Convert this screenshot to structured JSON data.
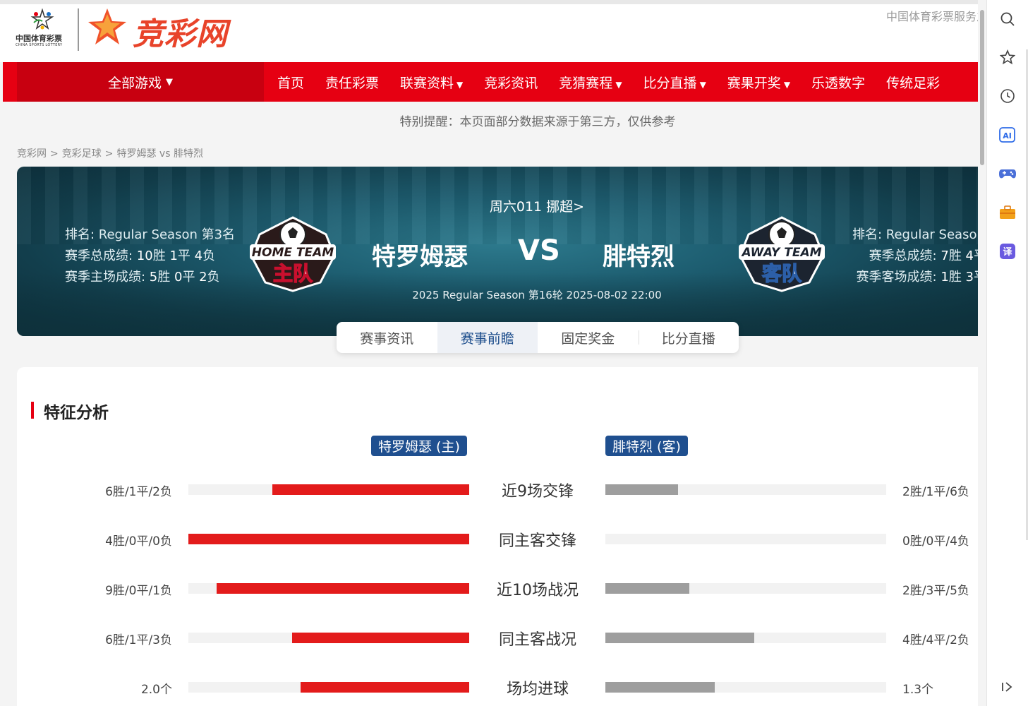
{
  "header": {
    "csl_logo_cn": "中国体育彩票",
    "csl_logo_en": "CHINA SPORTS LOTTERY",
    "site_logo": "竞彩网",
    "service_text": "中国体育彩票服务之"
  },
  "nav": {
    "all_games": "全部游戏",
    "items": [
      {
        "label": "首页",
        "caret": false
      },
      {
        "label": "责任彩票",
        "caret": false
      },
      {
        "label": "联赛资料",
        "caret": true
      },
      {
        "label": "竞彩资讯",
        "caret": false
      },
      {
        "label": "竞猜赛程",
        "caret": true
      },
      {
        "label": "比分直播",
        "caret": true
      },
      {
        "label": "赛果开奖",
        "caret": true
      },
      {
        "label": "乐透数字",
        "caret": false
      },
      {
        "label": "传统足彩",
        "caret": false
      }
    ]
  },
  "notice": "特别提醒：本页面部分数据来源于第三方，仅供参考",
  "breadcrumb": [
    "竞彩网",
    "竞彩足球",
    "特罗姆瑟 vs 腓特烈"
  ],
  "match": {
    "info": "周六011 挪超>",
    "vs": "VS",
    "meta": "2025 Regular Season 第16轮 2025-08-02 22:00",
    "home": {
      "name": "特罗姆瑟",
      "badge_text_en": "HOME TEAM",
      "badge_text_cn": "主队",
      "rank_label": "排名: Regular Season 第3名",
      "total_label": "赛季总成绩: ",
      "total_w": "10",
      "total_d": "1",
      "total_l": "4",
      "venue_label": "赛季主场成绩: ",
      "venue_w": "5",
      "venue_d": "0",
      "venue_l": "2"
    },
    "away": {
      "name": "腓特烈",
      "badge_text_en": "AWAY TEAM",
      "badge_text_cn": "客队",
      "rank_label": "排名: Regular Season 第",
      "total_label": "赛季总成绩: ",
      "total_w": "7",
      "total_d": "4",
      "venue_label": "赛季客场成绩: ",
      "venue_w": "1",
      "venue_d": "3"
    }
  },
  "tabs": [
    {
      "label": "赛事资讯",
      "active": false
    },
    {
      "label": "赛事前瞻",
      "active": true
    },
    {
      "label": "固定奖金",
      "active": false
    },
    {
      "label": "比分直播",
      "active": false
    }
  ],
  "analysis": {
    "title": "特征分析",
    "home_tag": "特罗姆瑟 (主)",
    "away_tag": "腓特烈 (客)",
    "rows": [
      {
        "label": "近9场交锋",
        "home": "6胜/1平/2负",
        "away": "2胜/1平/6负",
        "home_fill": 0.7,
        "away_fill": 0.26
      },
      {
        "label": "同主客交锋",
        "home": "4胜/0平/0负",
        "away": "0胜/0平/4负",
        "home_fill": 1.0,
        "away_fill": 0.0
      },
      {
        "label": "近10场战况",
        "home": "9胜/0平/1负",
        "away": "2胜/3平/5负",
        "home_fill": 0.9,
        "away_fill": 0.3
      },
      {
        "label": "同主客战况",
        "home": "6胜/1平/3负",
        "away": "4胜/4平/2负",
        "home_fill": 0.63,
        "away_fill": 0.53
      },
      {
        "label": "场均进球",
        "home": "2.0个",
        "away": "1.3个",
        "home_fill": 0.6,
        "away_fill": 0.39
      }
    ]
  },
  "colors": {
    "brand_red": "#e60012",
    "bar_home": "#e31b1b",
    "bar_away": "#9e9e9e",
    "tag_blue": "#1f4f8f"
  },
  "sidebar_icons": [
    "search-icon",
    "star-icon",
    "history-icon",
    "ai-icon",
    "gamepad-icon",
    "toolbox-icon",
    "translate-icon",
    "collapse-icon"
  ]
}
